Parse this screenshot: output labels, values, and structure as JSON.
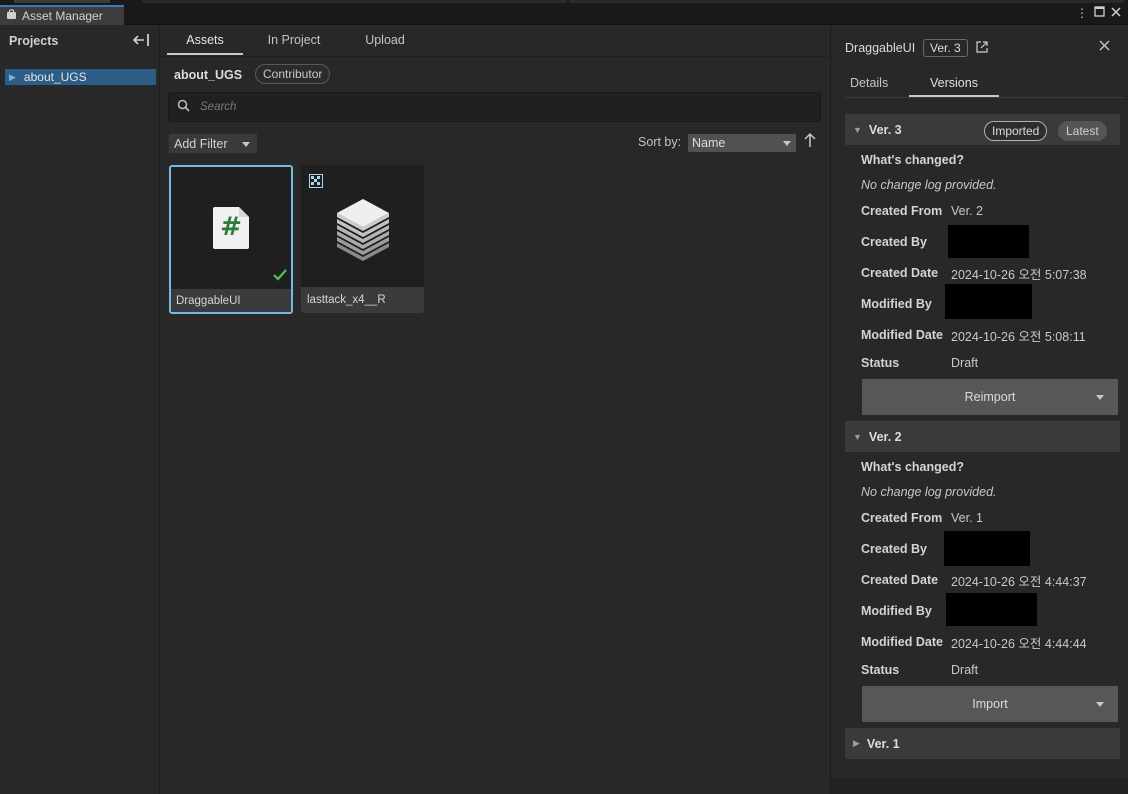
{
  "window": {
    "tab_title": "Asset Manager",
    "icons": [
      "asset-manager-icon",
      "more-options-icon",
      "maximize-icon",
      "close-window-icon"
    ]
  },
  "sidebar": {
    "title": "Projects",
    "collapse_icon": "collapse-left-icon",
    "items": [
      {
        "label": "about_UGS",
        "selected": true
      }
    ]
  },
  "center": {
    "tabs": [
      {
        "label": "Assets",
        "active": true
      },
      {
        "label": "In Project",
        "active": false
      },
      {
        "label": "Upload",
        "active": false
      }
    ],
    "project_name": "about_UGS",
    "role": "Contributor",
    "search": {
      "placeholder": "Search"
    },
    "add_filter_label": "Add Filter",
    "sort": {
      "label": "Sort by:",
      "value": "Name",
      "direction": "ascending"
    },
    "assets": [
      {
        "name": "DraggableUI",
        "icon": "csharp-script-icon",
        "glyph": "#",
        "selected": true,
        "imported": true
      },
      {
        "name": "lasttack_x4__R",
        "icon": "stacked-layers-icon",
        "badge_icon": "texture-badge-icon",
        "selected": false,
        "imported": false
      }
    ]
  },
  "details": {
    "asset_name": "DraggableUI",
    "version_badge": "Ver. 3",
    "tabs": [
      {
        "label": "Details",
        "active": false
      },
      {
        "label": "Versions",
        "active": true
      }
    ],
    "labels": {
      "whats_changed": "What's changed?",
      "created_from": "Created From",
      "created_by": "Created By",
      "created_date": "Created Date",
      "modified_by": "Modified By",
      "modified_date": "Modified Date",
      "status": "Status"
    },
    "versions": [
      {
        "title": "Ver.  3",
        "expanded": true,
        "tags": [
          "Imported",
          "Latest"
        ],
        "change_log": "No change log provided.",
        "created_from": "Ver.  2",
        "created_date": "2024-10-26 오전 5:07:38",
        "modified_date": "2024-10-26 오전 5:08:11",
        "status": "Draft",
        "action_label": "Reimport"
      },
      {
        "title": "Ver.  2",
        "expanded": true,
        "tags": [],
        "change_log": "No change log provided.",
        "created_from": "Ver.  1",
        "created_date": "2024-10-26 오전 4:44:37",
        "modified_date": "2024-10-26 오전 4:44:44",
        "status": "Draft",
        "action_label": "Import"
      },
      {
        "title": "Ver.  1",
        "expanded": false
      }
    ]
  },
  "colors": {
    "accent_selection": "#2c5d87",
    "card_selected_border": "#78b7e0",
    "check_green": "#4fc35a",
    "script_green": "#2f7d3a"
  }
}
